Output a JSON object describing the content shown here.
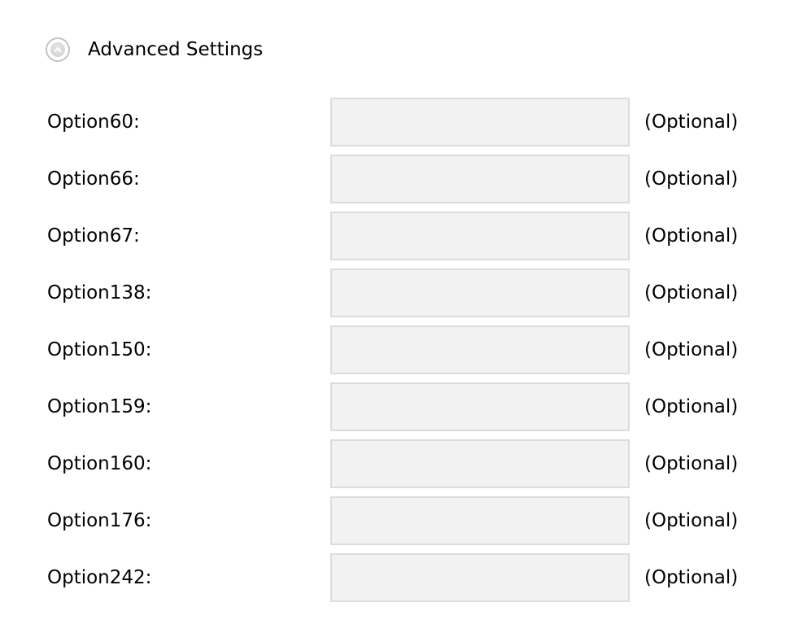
{
  "advanced": {
    "title": "Advanced Settings",
    "toggle_icon": "chevron-up-circle-icon",
    "expanded": true
  },
  "options": [
    {
      "label": "Option60:",
      "value": "",
      "hint": "(Optional)"
    },
    {
      "label": "Option66:",
      "value": "",
      "hint": "(Optional)"
    },
    {
      "label": "Option67:",
      "value": "",
      "hint": "(Optional)"
    },
    {
      "label": "Option138:",
      "value": "",
      "hint": "(Optional)"
    },
    {
      "label": "Option150:",
      "value": "",
      "hint": "(Optional)"
    },
    {
      "label": "Option159:",
      "value": "",
      "hint": "(Optional)"
    },
    {
      "label": "Option160:",
      "value": "",
      "hint": "(Optional)"
    },
    {
      "label": "Option176:",
      "value": "",
      "hint": "(Optional)"
    },
    {
      "label": "Option242:",
      "value": "",
      "hint": "(Optional)"
    }
  ],
  "colors": {
    "input_background": "#f2f2f2",
    "input_border": "#dcdcdc",
    "icon_ring": "#c4c4c4",
    "text": "#000000"
  }
}
